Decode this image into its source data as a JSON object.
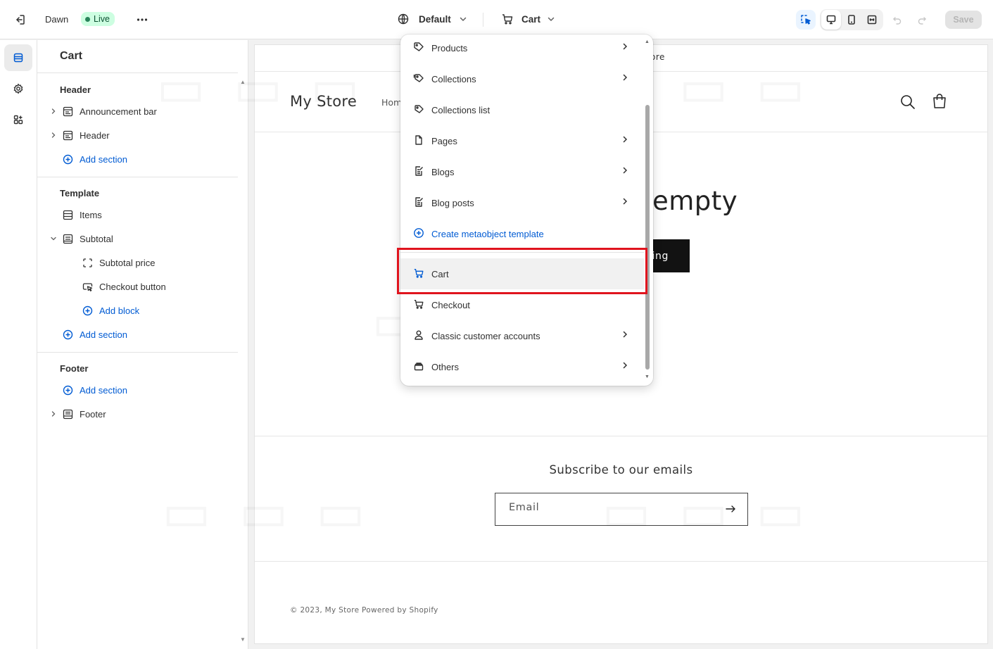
{
  "topbar": {
    "theme_name": "Dawn",
    "live_badge": "Live",
    "template_selector": "Default",
    "page_selector": "Cart",
    "save_label": "Save"
  },
  "sidebar": {
    "title": "Cart",
    "groups": {
      "header": {
        "title": "Header",
        "items": [
          "Announcement bar",
          "Header"
        ],
        "add_section": "Add section"
      },
      "template": {
        "title": "Template",
        "items": [
          "Items",
          "Subtotal"
        ],
        "subtotal_blocks": [
          "Subtotal price",
          "Checkout button"
        ],
        "add_block": "Add block",
        "add_section": "Add section"
      },
      "footer": {
        "title": "Footer",
        "add_section": "Add section",
        "items": [
          "Footer"
        ]
      }
    }
  },
  "dropdown": {
    "items": [
      {
        "label": "Products",
        "icon": "tag-icon",
        "has_submenu": true
      },
      {
        "label": "Collections",
        "icon": "collections-icon",
        "has_submenu": true
      },
      {
        "label": "Collections list",
        "icon": "collections-list-icon",
        "has_submenu": false
      },
      {
        "label": "Pages",
        "icon": "page-icon",
        "has_submenu": true
      },
      {
        "label": "Blogs",
        "icon": "blog-icon",
        "has_submenu": true
      },
      {
        "label": "Blog posts",
        "icon": "blog-post-icon",
        "has_submenu": true
      },
      {
        "label": "Create metaobject template",
        "icon": "plus-circle-icon",
        "has_submenu": false
      },
      {
        "label": "Cart",
        "icon": "cart-icon",
        "has_submenu": false,
        "selected": true
      },
      {
        "label": "Checkout",
        "icon": "cart-icon",
        "has_submenu": false
      },
      {
        "label": "Classic customer accounts",
        "icon": "person-icon",
        "has_submenu": true
      },
      {
        "label": "Others",
        "icon": "others-icon",
        "has_submenu": true
      }
    ]
  },
  "preview": {
    "announcement": "ore",
    "store_name": "My Store",
    "nav_home": "Hom",
    "cart_empty": "empty",
    "cta": "ing",
    "subscribe_heading": "Subscribe to our emails",
    "email_placeholder": "Email",
    "copyright": "© 2023, My Store Powered by Shopify"
  },
  "colors": {
    "accent_blue": "#005bd3",
    "live_badge_bg": "#cdfee1",
    "highlight_red": "#e0141e"
  }
}
